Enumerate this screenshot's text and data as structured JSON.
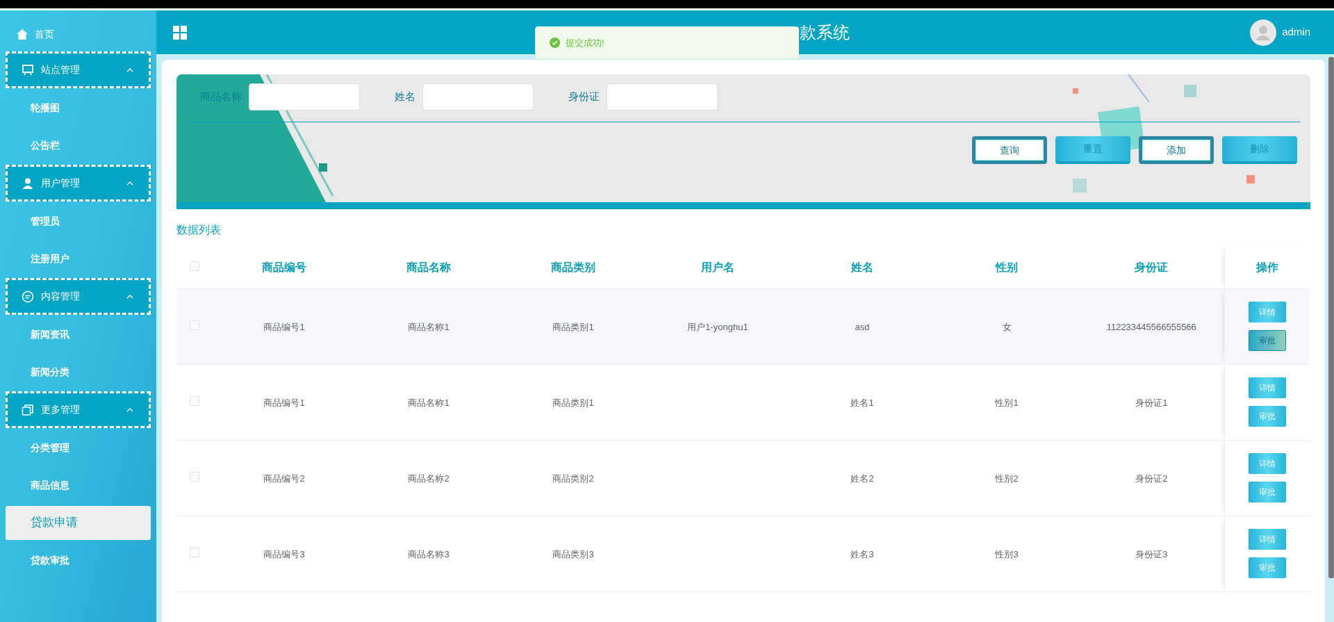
{
  "header": {
    "title": "款系统",
    "user": "admin"
  },
  "toast": {
    "message": "提交成功!"
  },
  "sidebar": {
    "items": [
      {
        "kind": "link",
        "label": "首页",
        "selected": false
      },
      {
        "kind": "group",
        "label": "站点管理",
        "expanded": true,
        "children": [
          {
            "label": "轮播图",
            "selected": false
          },
          {
            "label": "公告栏",
            "selected": false
          }
        ]
      },
      {
        "kind": "group",
        "label": "用户管理",
        "expanded": true,
        "children": [
          {
            "label": "管理员",
            "selected": false
          },
          {
            "label": "注册用户",
            "selected": false
          }
        ]
      },
      {
        "kind": "group",
        "label": "内容管理",
        "expanded": true,
        "children": [
          {
            "label": "新闻资讯",
            "selected": false
          },
          {
            "label": "新闻分类",
            "selected": false
          }
        ]
      },
      {
        "kind": "group",
        "label": "更多管理",
        "expanded": true,
        "children": [
          {
            "label": "分类管理",
            "selected": false
          },
          {
            "label": "商品信息",
            "selected": false
          },
          {
            "label": "贷款申请",
            "selected": true
          },
          {
            "label": "贷款审批",
            "selected": false
          }
        ]
      }
    ]
  },
  "filters": [
    {
      "label": "商品名称"
    },
    {
      "label": "姓名"
    },
    {
      "label": "身份证"
    }
  ],
  "buttons": [
    {
      "label": "查询",
      "kind": "outlined"
    },
    {
      "label": "重置",
      "kind": "filled"
    },
    {
      "label": "添加",
      "kind": "outlined"
    },
    {
      "label": "删除",
      "kind": "filled"
    }
  ],
  "section_title": "数据列表",
  "table": {
    "select_all": {
      "checked": false
    },
    "columns": [
      "商品编号",
      "商品名称",
      "商品类别",
      "用户名",
      "姓名",
      "性别",
      "身份证",
      "操作"
    ],
    "rows": [
      {
        "checked": false,
        "hovered": true,
        "cells": [
          "商品编号1",
          "商品名称1",
          "商品类别1",
          "用户1-yonghu1",
          "asd",
          "女",
          "112233445566555566"
        ],
        "actions": [
          "详情",
          "审批"
        ]
      },
      {
        "checked": false,
        "hovered": false,
        "cells": [
          "商品编号1",
          "商品名称1",
          "商品类别1",
          "",
          "姓名1",
          "性别1",
          "身份证1"
        ],
        "actions": [
          "详情",
          "审批"
        ]
      },
      {
        "checked": false,
        "hovered": false,
        "cells": [
          "商品编号2",
          "商品名称2",
          "商品类别2",
          "",
          "姓名2",
          "性别2",
          "身份证2"
        ],
        "actions": [
          "详情",
          "审批"
        ]
      },
      {
        "checked": false,
        "hovered": false,
        "cells": [
          "商品编号3",
          "商品名称3",
          "商品类别3",
          "",
          "姓名3",
          "性别3",
          "身份证3"
        ],
        "actions": [
          "详情",
          "审批"
        ]
      }
    ]
  }
}
